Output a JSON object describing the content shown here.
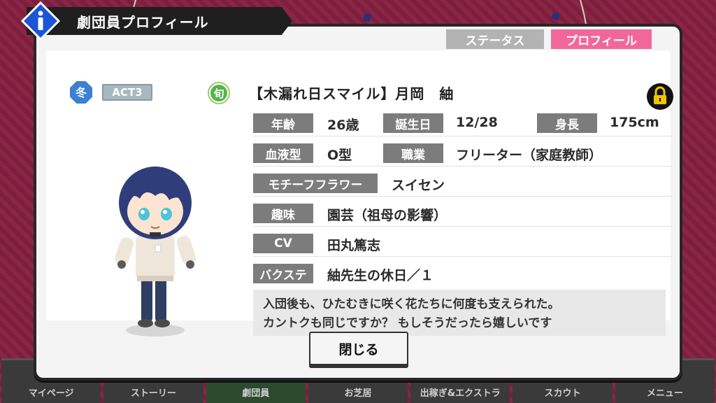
{
  "window": {
    "title": "劇団員プロフィール"
  },
  "tabs": [
    {
      "label": "ステータス"
    },
    {
      "label": "プロフィール"
    }
  ],
  "badges": {
    "season": "冬",
    "act": "ACT3",
    "shun": "旬"
  },
  "character": {
    "name": "【木漏れ日スマイル】月岡　紬",
    "age_label": "年齢",
    "age": "26歳",
    "birthday_label": "誕生日",
    "birthday": "12/28",
    "height_label": "身長",
    "height": "175cm",
    "blood_label": "血液型",
    "blood": "O型",
    "job_label": "職業",
    "job": "フリーター（家庭教師）",
    "flower_label": "モチーフフラワー",
    "flower": "スイセン",
    "hobby_label": "趣味",
    "hobby": "園芸（祖母の影響）",
    "cv_label": "CV",
    "cv": "田丸篤志",
    "backstage_label": "バクステ",
    "backstage": "紬先生の休日／１",
    "comment_line1": "入団後も、ひたむきに咲く花たちに何度も支えられた。",
    "comment_line2": "カントクも同じですか？ もしそうだったら嬉しいです"
  },
  "buttons": {
    "close": "閉じる"
  },
  "bottom_nav": [
    {
      "label": "マイページ"
    },
    {
      "label": "ストーリー"
    },
    {
      "label": "劇団員"
    },
    {
      "label": "お芝居"
    },
    {
      "label": "出稼ぎ&エクストラ"
    },
    {
      "label": "スカウト"
    },
    {
      "label": "メニュー"
    }
  ],
  "colors": {
    "profile_tab": "#f2679a",
    "status_tab": "#b3b3b3",
    "label_bg": "#7c7c7c"
  }
}
